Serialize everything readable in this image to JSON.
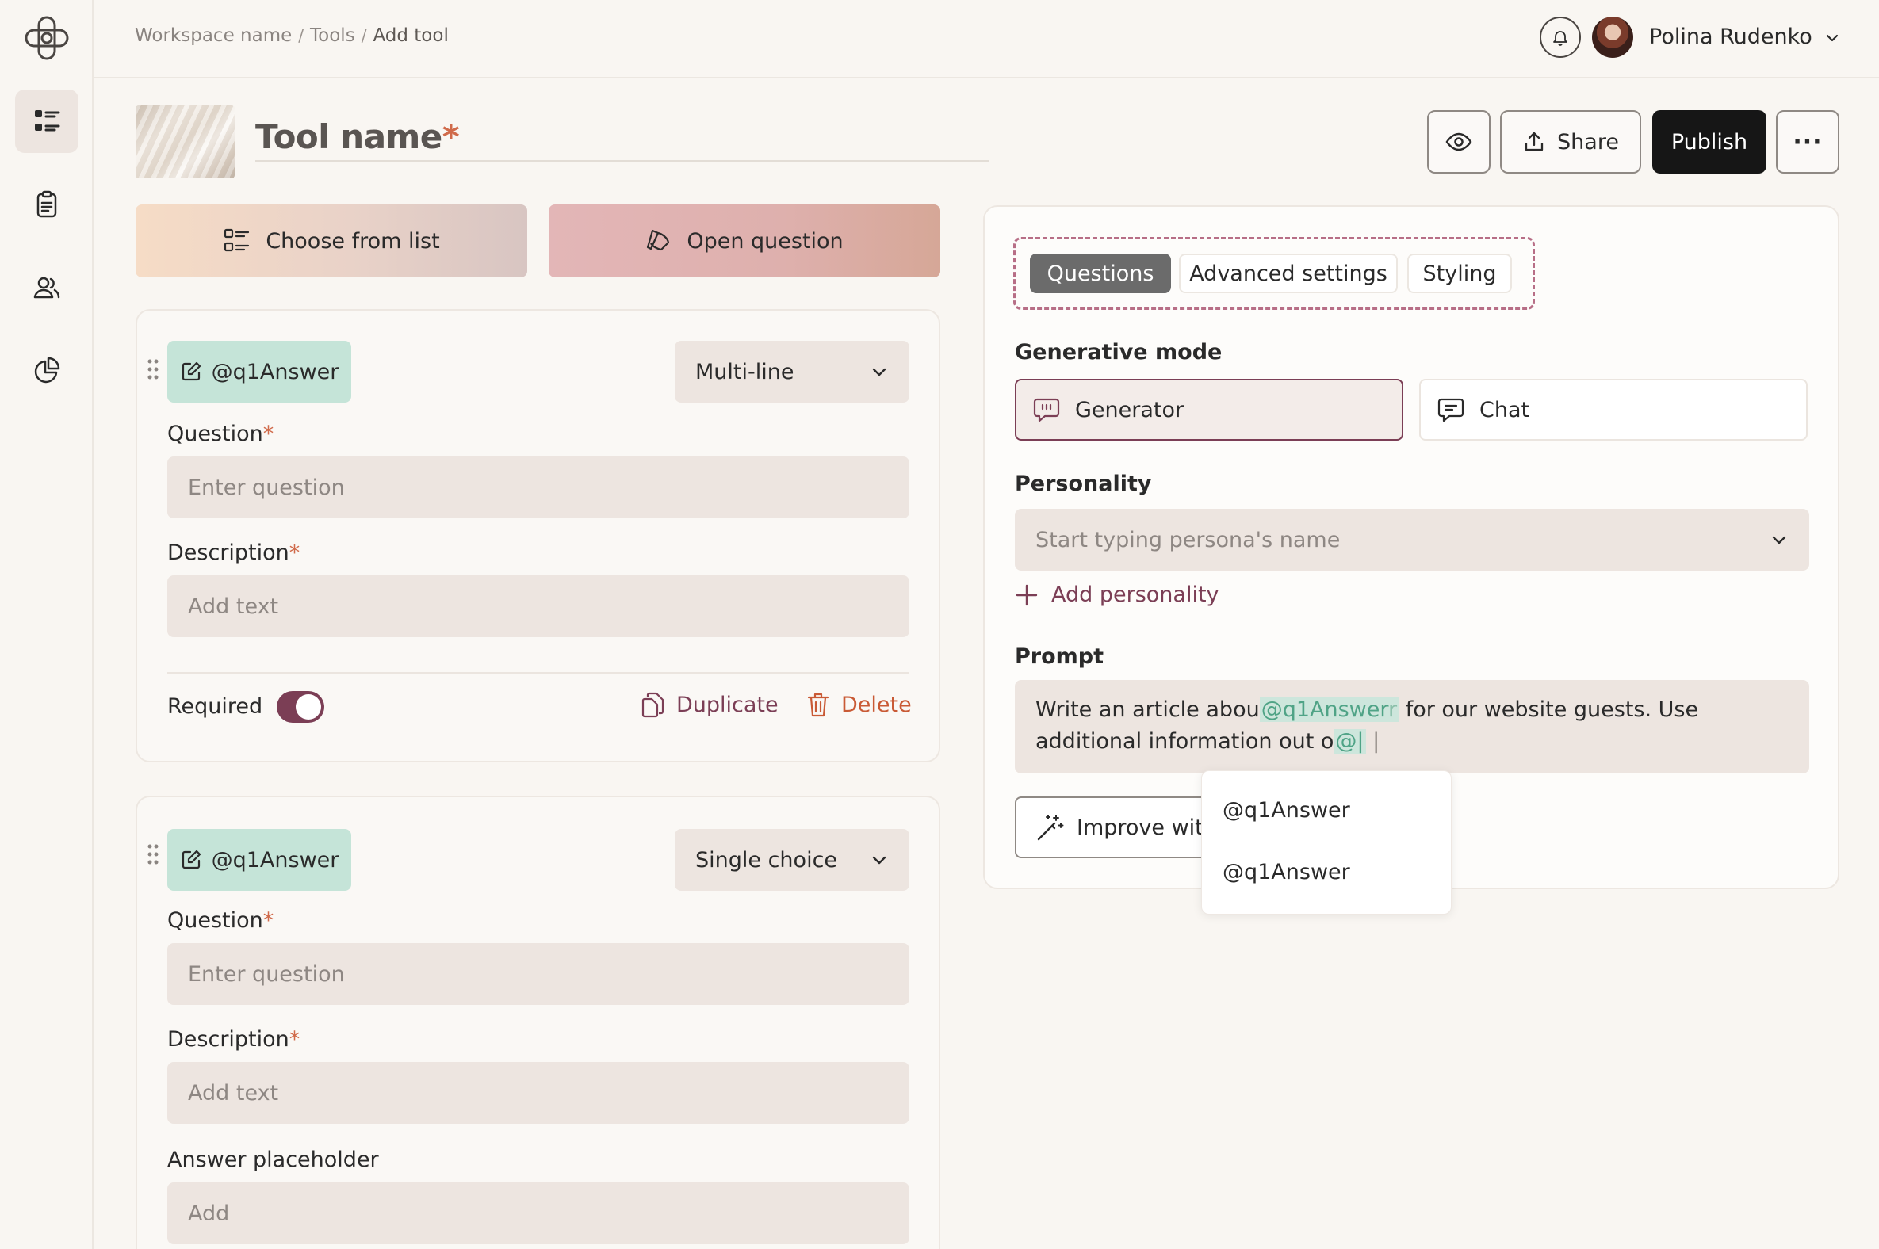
{
  "breadcrumb": {
    "workspace": "Workspace name",
    "sep1": "/",
    "tools": "Tools",
    "sep2": "/",
    "current": "Add tool"
  },
  "user": {
    "name": "Polina Rudenko"
  },
  "tool": {
    "name": "Tool name",
    "required_mark": "*"
  },
  "actions": {
    "share": "Share",
    "publish": "Publish",
    "more": "···"
  },
  "question_types": {
    "choose_list": "Choose from list",
    "open_question": "Open question"
  },
  "questions": [
    {
      "variable": "@q1Answer",
      "type": "Multi-line",
      "question_label": "Question",
      "question_placeholder": "Enter question",
      "description_label": "Description",
      "description_placeholder": "Add text",
      "required_label": "Required",
      "duplicate": "Duplicate",
      "delete": "Delete"
    },
    {
      "variable": "@q1Answer",
      "type": "Single choice",
      "question_label": "Question",
      "question_placeholder": "Enter question",
      "description_label": "Description",
      "description_placeholder": "Add text",
      "answer_placeholder_label": "Answer placeholder",
      "answer_placeholder_value": "Add"
    }
  ],
  "panel": {
    "tabs": [
      "Questions",
      "Advanced settings",
      "Styling"
    ],
    "generative_mode_label": "Generative mode",
    "modes": [
      "Generator",
      "Chat"
    ],
    "personality_label": "Personality",
    "personality_placeholder": "Start typing persona's name",
    "add_personality": "Add personality",
    "prompt_label": "Prompt",
    "prompt": {
      "part1": "Write an article abou",
      "mention": "@q1Answer",
      "mention_tail": "r",
      "part2": " for our website guests. Use additional information out o",
      "typing": "@|",
      "cursor": " |"
    },
    "improve": "Improve with"
  },
  "mention_dropdown": [
    "@q1Answer",
    "@q1Answer"
  ],
  "colors": {
    "accent": "#7b3e55",
    "danger": "#c95a35",
    "chip": "#c5e4d8",
    "publish": "#161616"
  }
}
